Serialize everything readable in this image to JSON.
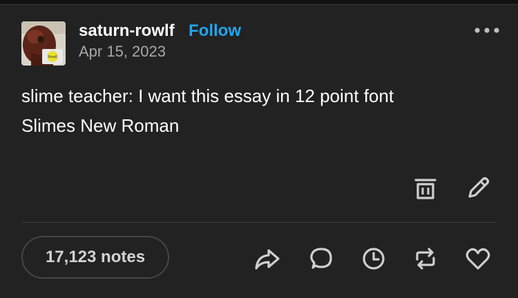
{
  "post": {
    "username": "saturn-rowlf",
    "follow_label": "Follow",
    "date": "Apr 15, 2023",
    "body_lines": [
      "slime teacher: I want this essay in 12 point font",
      "Slimes New Roman"
    ],
    "notes_label": "17,123 notes",
    "avatar_badge_text": "Rowlf"
  },
  "icons": {
    "more": "more-horizontal-icon",
    "delete": "trash-icon",
    "edit": "pencil-icon",
    "share": "share-arrow-icon",
    "reply": "speech-bubble-icon",
    "queue": "clock-icon",
    "reblog": "reblog-icon",
    "like": "heart-icon"
  },
  "colors": {
    "background": "#222222",
    "text": "#ffffff",
    "muted": "#a8a8a8",
    "accent": "#1ea7ee"
  }
}
